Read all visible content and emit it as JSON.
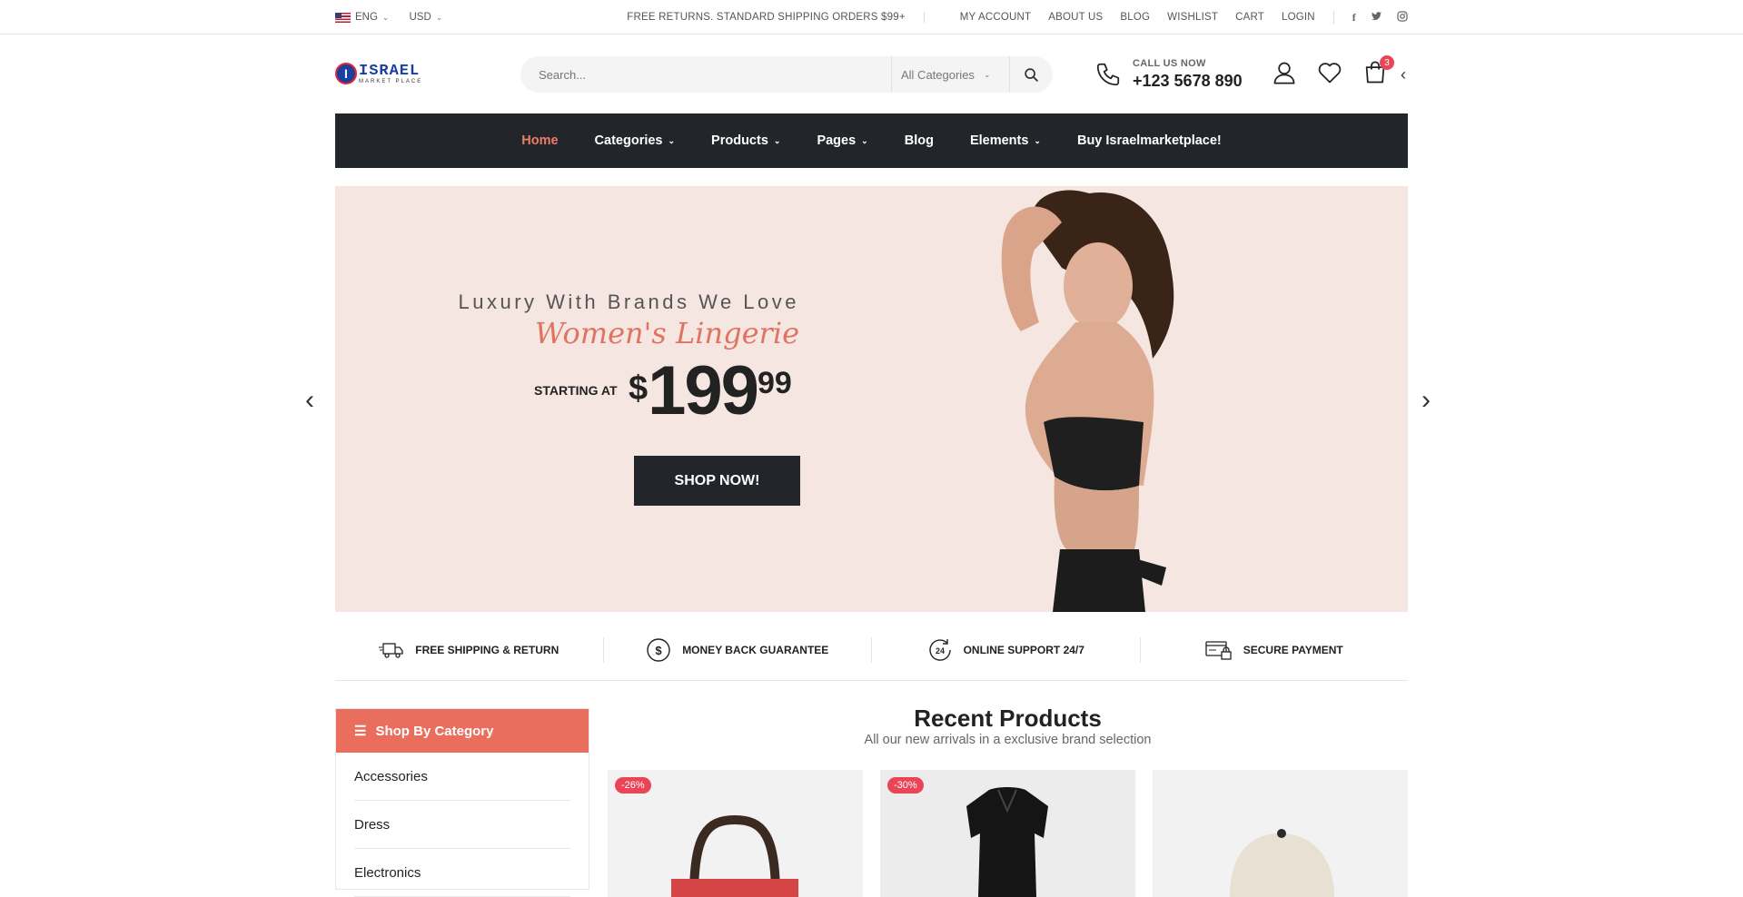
{
  "topbar": {
    "language": "ENG",
    "currency": "USD",
    "promo": "FREE RETURNS. STANDARD SHIPPING ORDERS $99+",
    "links": [
      "MY ACCOUNT",
      "ABOUT US",
      "BLOG",
      "WISHLIST",
      "CART",
      "LOGIN"
    ],
    "social": [
      "facebook-icon",
      "twitter-icon",
      "instagram-icon"
    ]
  },
  "header": {
    "logo_title": "ISRAEL",
    "logo_sub": "MARKET PLACE",
    "search_placeholder": "Search...",
    "category_select": "All Categories",
    "call_label": "CALL US NOW",
    "call_number": "+123 5678 890",
    "cart_count": "3"
  },
  "nav": {
    "items": [
      {
        "label": "Home",
        "active": true,
        "dropdown": false
      },
      {
        "label": "Categories",
        "dropdown": true
      },
      {
        "label": "Products",
        "dropdown": true
      },
      {
        "label": "Pages",
        "dropdown": true
      },
      {
        "label": "Blog",
        "dropdown": false
      },
      {
        "label": "Elements",
        "dropdown": true
      },
      {
        "label": "Buy Israelmarketplace!",
        "dropdown": false
      }
    ]
  },
  "hero": {
    "subtitle": "Luxury With Brands We Love",
    "script": "Women's Lingerie",
    "starting_at": "STARTING AT",
    "price_currency": "$",
    "price_main": "199",
    "price_cents": "99",
    "button": "SHOP NOW!"
  },
  "features": [
    {
      "icon": "truck-icon",
      "label": "FREE SHIPPING & RETURN"
    },
    {
      "icon": "dollar-icon",
      "label": "MONEY BACK GUARANTEE"
    },
    {
      "icon": "support-24-icon",
      "label": "ONLINE SUPPORT 24/7"
    },
    {
      "icon": "card-lock-icon",
      "label": "SECURE PAYMENT"
    }
  ],
  "sidebar": {
    "title": "Shop By Category",
    "items": [
      "Accessories",
      "Dress",
      "Electronics"
    ]
  },
  "recent": {
    "title": "Recent Products",
    "subtitle": "All our new arrivals in a exclusive brand selection",
    "products": [
      {
        "discount": "-26%",
        "image": "handbag"
      },
      {
        "discount": "-30%",
        "image": "black-top"
      },
      {
        "discount": "",
        "image": "cap"
      }
    ]
  },
  "colors": {
    "accent": "#e96e5d",
    "dark": "#222529",
    "hero_bg": "#f5e6e2",
    "badge": "#ea4556"
  }
}
